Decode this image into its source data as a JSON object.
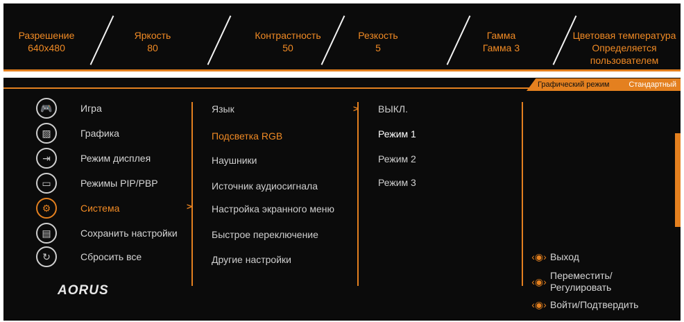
{
  "top_stats": [
    {
      "label": "Разрешение",
      "value": "640x480"
    },
    {
      "label": "Яркость",
      "value": "80"
    },
    {
      "label": "Контрастность",
      "value": "50"
    },
    {
      "label": "Резкость",
      "value": "5"
    },
    {
      "label": "Гамма",
      "value": "Гамма 3"
    },
    {
      "label": "Цветовая температура",
      "value": "Определяется",
      "value2": "пользователем"
    }
  ],
  "mode_bar": {
    "label": "Графический режим",
    "value": "Стандартный"
  },
  "main_menu": [
    {
      "label": "Игра",
      "icon": "gamepad-icon"
    },
    {
      "label": "Графика",
      "icon": "picture-icon"
    },
    {
      "label": "Режим дисплея",
      "icon": "input-icon"
    },
    {
      "label": "Режимы PIP/PBP",
      "icon": "pip-icon"
    },
    {
      "label": "Система",
      "icon": "gear-icon"
    },
    {
      "label": "Сохранить настройки",
      "icon": "save-icon"
    },
    {
      "label": "Сбросить все",
      "icon": "reset-icon"
    }
  ],
  "sub_menu": [
    "Язык",
    "Подсветка RGB",
    "Наушники",
    "Источник аудиосигнала",
    "Настройка экранного меню",
    "Быстрое переключение",
    "Другие настройки"
  ],
  "options": [
    "ВЫКЛ.",
    "Режим 1",
    "Режим 2",
    "Режим 3"
  ],
  "logo": "AORUS",
  "hints": [
    {
      "text": "Выход"
    },
    {
      "text": "Переместить/",
      "text2": "Регулировать"
    },
    {
      "text": "Войти/Подтвердить"
    }
  ],
  "colors": {
    "accent": "#e4801f",
    "background": "#0b0b0b"
  }
}
